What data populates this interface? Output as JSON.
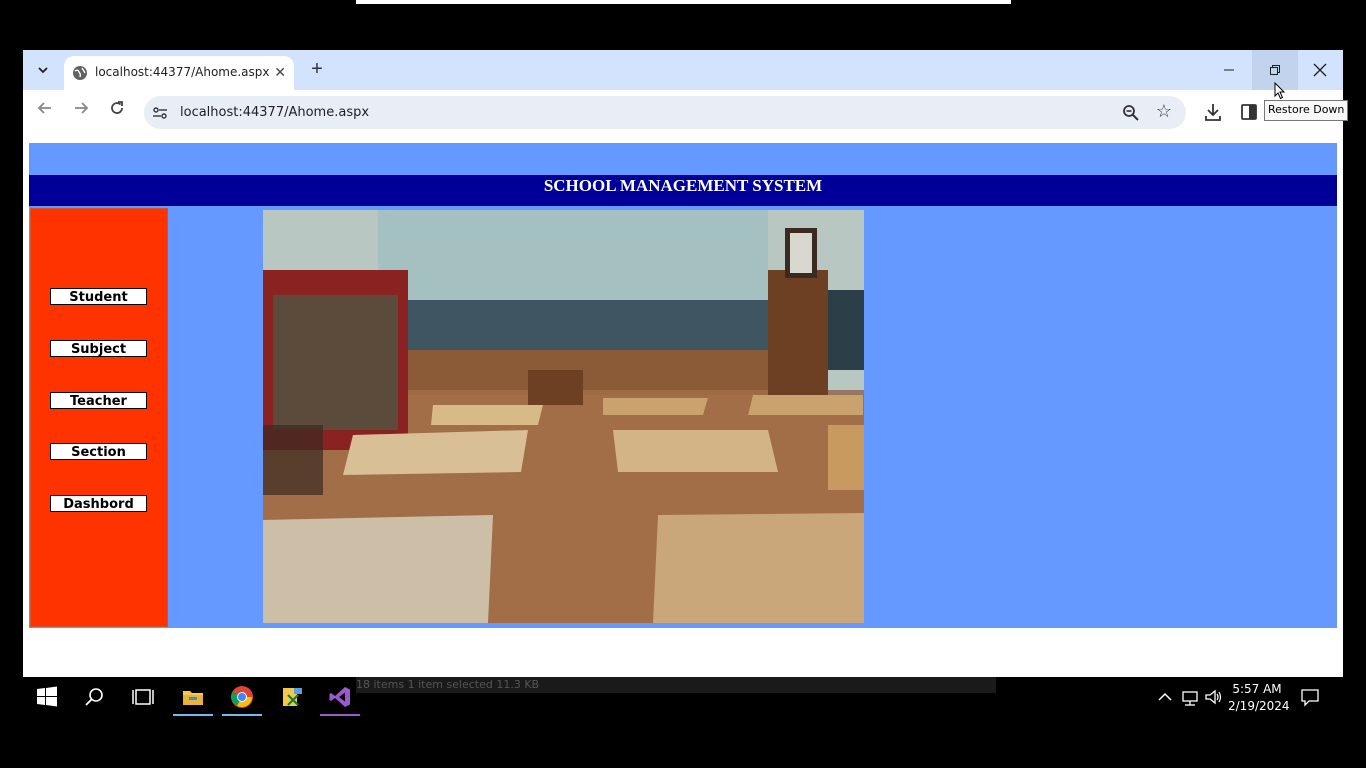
{
  "browser": {
    "tab_title": "localhost:44377/Ahome.aspx",
    "url": "localhost:44377/Ahome.aspx",
    "tooltip": "Restore Down"
  },
  "page": {
    "banner_title": "SCHOOL MANAGEMENT SYSTEM",
    "nav": [
      "Student",
      "Subject",
      "Teacher",
      "Section",
      "Dashbord"
    ]
  },
  "taskbar": {
    "status_ghost": "18 items      1 item selected  11.3 KB",
    "time": "5:57 AM",
    "date": "2/19/2024"
  },
  "colors": {
    "page_bg": "#6699ff",
    "banner_bg": "#000099",
    "sidebar_bg": "#ff3300"
  }
}
